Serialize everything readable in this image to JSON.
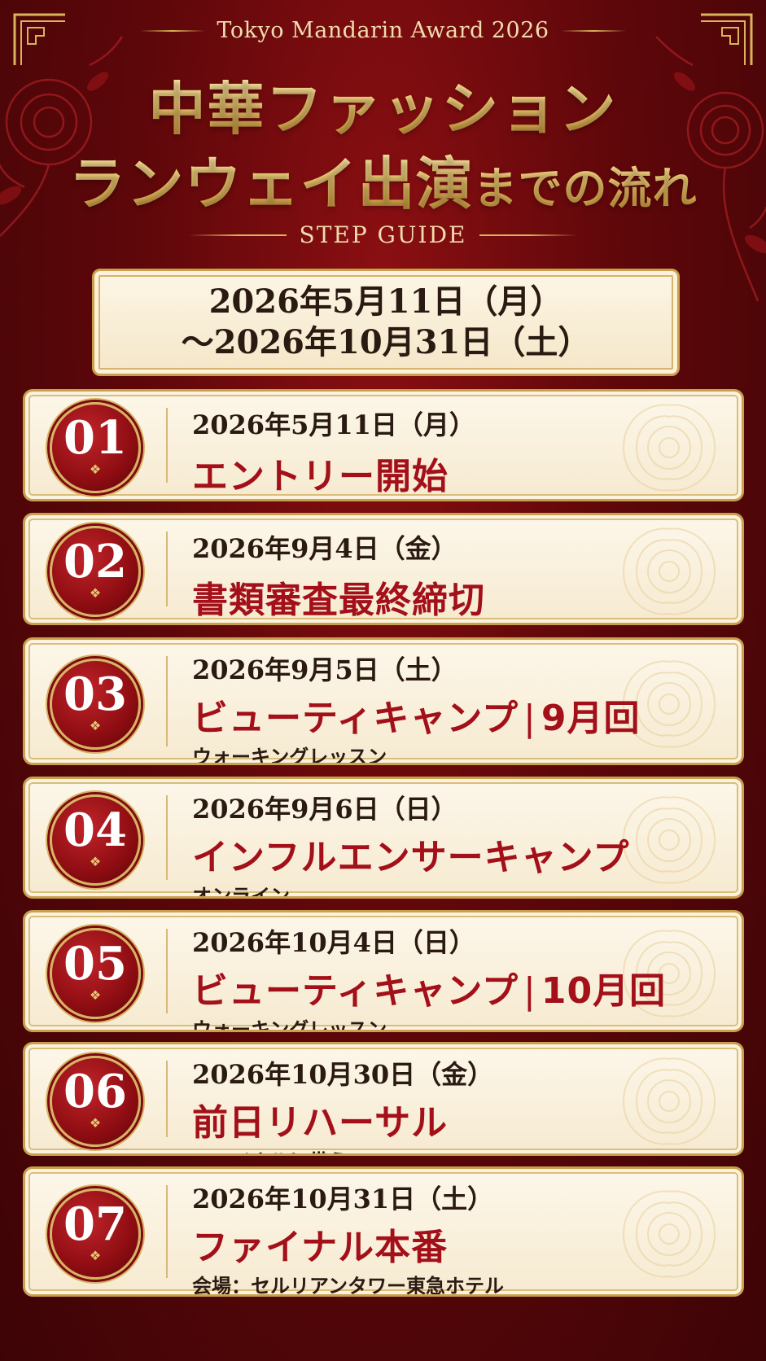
{
  "header": {
    "subtitle": "Tokyo Mandarin Award 2026",
    "title_line1": "中華ファッション",
    "title_line2_main": "ランウェイ出演",
    "title_line2_small": "までの流れ",
    "guide": "STEP GUIDE"
  },
  "period": {
    "line1": "2026年5月11日（月）",
    "line2": "〜2026年10月31日（土）"
  },
  "steps": [
    {
      "num": "01",
      "date": "2026年5月11日（月）",
      "event": "エントリー開始",
      "event_suffix": "",
      "note": ""
    },
    {
      "num": "02",
      "date": "2026年9月4日（金）",
      "event": "書類審査最終締切",
      "event_suffix": "",
      "note": ""
    },
    {
      "num": "03",
      "date": "2026年9月5日（土）",
      "event": "ビューティキャンプ",
      "event_suffix": "9月回",
      "note": "ウォーキングレッスン"
    },
    {
      "num": "04",
      "date": "2026年9月6日（日）",
      "event": "インフルエンサーキャンプ",
      "event_suffix": "",
      "note": "オンライン"
    },
    {
      "num": "05",
      "date": "2026年10月4日（日）",
      "event": "ビューティキャンプ",
      "event_suffix": "10月回",
      "note": "ウォーキングレッスン"
    },
    {
      "num": "06",
      "date": "2026年10月30日（金）",
      "event": "前日リハーサル",
      "event_suffix": "",
      "note": "ファイナルに備えて"
    },
    {
      "num": "07",
      "date": "2026年10月31日（土）",
      "event": "ファイナル本番",
      "event_suffix": "",
      "note": "会場：セルリアンタワー東急ホテル"
    }
  ],
  "colors": {
    "background": "#6e0a0e",
    "gold": "#d9b45a",
    "card": "#fbf2df",
    "accent_red": "#a3101a"
  }
}
